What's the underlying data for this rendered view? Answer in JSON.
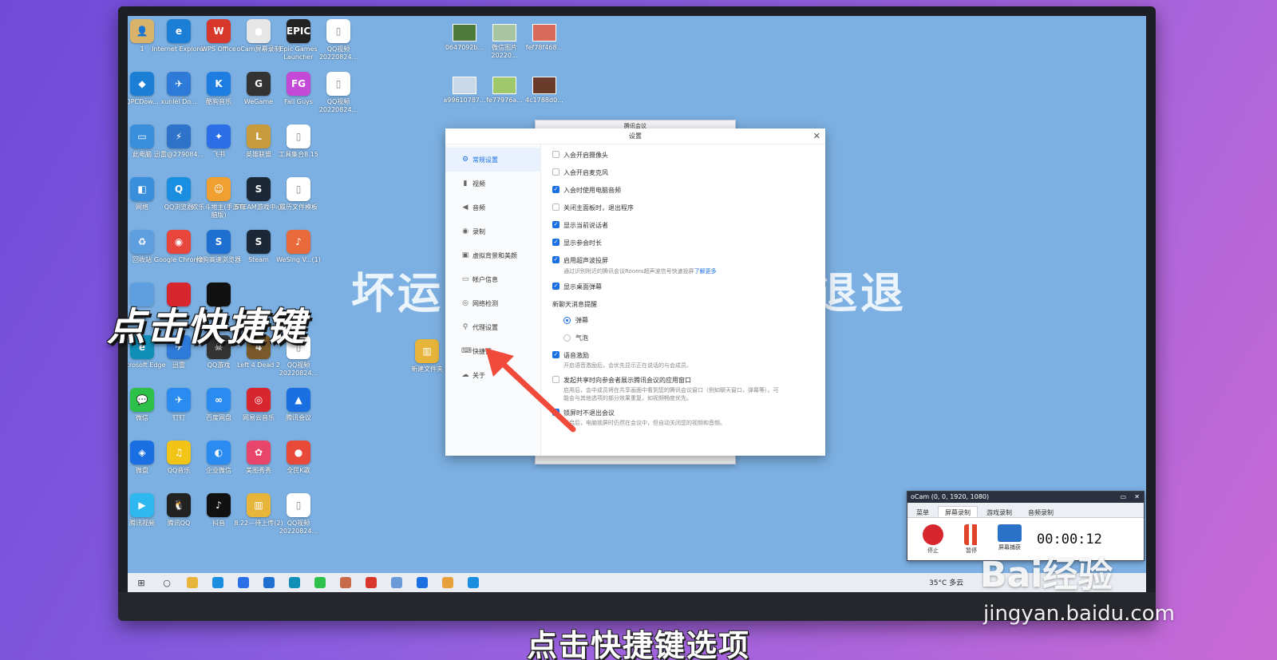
{
  "desktop": {
    "icons": [
      {
        "label": "1",
        "glyph": "👤",
        "color": "#d9b36a"
      },
      {
        "label": "Internet Explorer",
        "glyph": "e",
        "color": "#1c7fd6"
      },
      {
        "label": "WPS Office",
        "glyph": "W",
        "color": "#d8372c"
      },
      {
        "label": "oCam屏幕录制",
        "glyph": "●",
        "color": "#e7e7e7"
      },
      {
        "label": "Epic Games Launcher",
        "glyph": "EPIC",
        "color": "#222222"
      },
      {
        "label": "QQ视频20220824...",
        "glyph": "▯",
        "color": "#ffffff"
      },
      {
        "label": "QPCDow...",
        "glyph": "◆",
        "color": "#1c7fd6"
      },
      {
        "label": "xunlei Do...",
        "glyph": "✈",
        "color": "#2e7ad8"
      },
      {
        "label": "酷狗音乐",
        "glyph": "K",
        "color": "#1e7de0"
      },
      {
        "label": "WeGame",
        "glyph": "G",
        "color": "#333333"
      },
      {
        "label": "Fall Guys",
        "glyph": "FG",
        "color": "#c24ad6"
      },
      {
        "label": "QQ视频20220824...",
        "glyph": "▯",
        "color": "#ffffff"
      },
      {
        "label": "此电脑",
        "glyph": "▭",
        "color": "#3a8fdc"
      },
      {
        "label": "迅雷@279084...",
        "glyph": "⚡",
        "color": "#2d73c9"
      },
      {
        "label": "飞书",
        "glyph": "✦",
        "color": "#2b6fe8"
      },
      {
        "label": "英雄联盟",
        "glyph": "L",
        "color": "#c89b3c"
      },
      {
        "label": "工具集合8.15",
        "glyph": "▯",
        "color": "#ffffff"
      },
      {
        "label": "网络",
        "glyph": "◧",
        "color": "#3a8fdc"
      },
      {
        "label": "QQ浏览器",
        "glyph": "Q",
        "color": "#1a8ee0"
      },
      {
        "label": "欢乐斗地主(手游电脑版)",
        "glyph": "☺",
        "color": "#f0a030"
      },
      {
        "label": "STEAM游戏中心",
        "glyph": "S",
        "color": "#1b2838"
      },
      {
        "label": "履历文件模板",
        "glyph": "▯",
        "color": "#ffffff"
      },
      {
        "label": "回收站",
        "glyph": "♻",
        "color": "#5ea0df"
      },
      {
        "label": "Google Chrome",
        "glyph": "◉",
        "color": "#e8453c"
      },
      {
        "label": "搜狗高速浏览器",
        "glyph": "S",
        "color": "#1f6fd0"
      },
      {
        "label": "Steam",
        "glyph": "S",
        "color": "#1b2838"
      },
      {
        "label": "WeSing V...(1)",
        "glyph": "♪",
        "color": "#e86a3a"
      },
      {
        "label": "Microsoft Edge",
        "glyph": "e",
        "color": "#0f8fb8"
      },
      {
        "label": "迅雷",
        "glyph": "✈",
        "color": "#2e7ad8"
      },
      {
        "label": "QQ游戏",
        "glyph": "☠",
        "color": "#333333"
      },
      {
        "label": "Left 4 Dead 2",
        "glyph": "4",
        "color": "#7a5a2a"
      },
      {
        "label": "QQ视频20220824...",
        "glyph": "▯",
        "color": "#ffffff"
      },
      {
        "label": "微信",
        "glyph": "💬",
        "color": "#2ec14a"
      },
      {
        "label": "钉钉",
        "glyph": "✈",
        "color": "#2a8cf0"
      },
      {
        "label": "百度网盘",
        "glyph": "∞",
        "color": "#2a8cf0"
      },
      {
        "label": "网易云音乐",
        "glyph": "◎",
        "color": "#d8262e"
      },
      {
        "label": "腾讯会议",
        "glyph": "▲",
        "color": "#1a6fe3"
      },
      {
        "label": "微盘",
        "glyph": "◈",
        "color": "#1a6fe3"
      },
      {
        "label": "QQ音乐",
        "glyph": "♫",
        "color": "#f2c417"
      },
      {
        "label": "企业微信",
        "glyph": "◐",
        "color": "#2a8cf0"
      },
      {
        "label": "美图秀秀",
        "glyph": "✿",
        "color": "#e8456a"
      },
      {
        "label": "全民K歌",
        "glyph": "●",
        "color": "#e84a3a"
      },
      {
        "label": "腾讯视频",
        "glyph": "▶",
        "color": "#2fb8ef"
      },
      {
        "label": "腾讯QQ",
        "glyph": "🐧",
        "color": "#222222"
      },
      {
        "label": "抖音",
        "glyph": "♪",
        "color": "#111111"
      },
      {
        "label": "8.22—待上传(2)",
        "glyph": "▥",
        "color": "#e6b53a"
      },
      {
        "label": "QQ视频20220824...",
        "glyph": "▯",
        "color": "#ffffff"
      }
    ],
    "folder_label": "新建文件夹",
    "thumbs": [
      {
        "label": "0647092b...",
        "color": "#4d7a3a"
      },
      {
        "label": "微信图片20220...",
        "color": "#a6c5a0"
      },
      {
        "label": "fef78f468...",
        "color": "#d96a5a"
      },
      {
        "label": "a99610787...",
        "color": "#c8d8e8"
      },
      {
        "label": "fe77976a...",
        "color": "#9ec86a"
      },
      {
        "label": "4c1788d0...",
        "color": "#6a3a2a"
      }
    ],
    "bg_text_left": "坏运",
    "bg_text_right": "退退"
  },
  "behind_window_title": "腾讯会议",
  "settings": {
    "title": "设置",
    "close": "✕",
    "sidebar": [
      {
        "label": "常规设置",
        "icon": "⚙",
        "active": true
      },
      {
        "label": "视频",
        "icon": "▮",
        "active": false
      },
      {
        "label": "音频",
        "icon": "◀",
        "active": false
      },
      {
        "label": "录制",
        "icon": "◉",
        "active": false
      },
      {
        "label": "虚拟背景和美颜",
        "icon": "▣",
        "active": false
      },
      {
        "label": "帐户信息",
        "icon": "▭",
        "active": false
      },
      {
        "label": "网络检测",
        "icon": "◎",
        "active": false
      },
      {
        "label": "代理设置",
        "icon": "⚲",
        "active": false
      },
      {
        "label": "快捷键",
        "icon": "⌨",
        "active": false
      },
      {
        "label": "关于",
        "icon": "☁",
        "active": false
      }
    ],
    "options": [
      {
        "label": "入会开启摄像头",
        "checked": false
      },
      {
        "label": "入会开启麦克风",
        "checked": false
      },
      {
        "label": "入会时使用电脑音频",
        "checked": true
      },
      {
        "label": "关闭主面板时，退出程序",
        "checked": false
      },
      {
        "label": "显示当前说话者",
        "checked": true
      },
      {
        "label": "显示参会时长",
        "checked": true
      },
      {
        "label": "启用超声波投屏",
        "checked": true
      }
    ],
    "ultrasonic_desc": "通过识别附近的腾讯会议Rooms超声波信号快速投屏",
    "learn_more": "了解更多",
    "option_barrage": {
      "label": "显示桌面弹幕",
      "checked": true
    },
    "chat_section": "新聊天消息提醒",
    "radio_options": [
      {
        "label": "弹幕",
        "selected": true
      },
      {
        "label": "气泡",
        "selected": false
      }
    ],
    "voice_option": {
      "label": "语音激励",
      "checked": true
    },
    "voice_desc": "开启语音激励后，会优先显示正在说话的与会成员。",
    "share_option": {
      "label": "发起共享时向参会者展示腾讯会议的应用窗口",
      "checked": false
    },
    "share_desc": "启用后，会中成员将在共享画面中看到您的腾讯会议窗口（例如聊天窗口，弹幕等）。可能会与其他选项的部分效果重复，如视频畅度优先。",
    "lock_option": {
      "label": "锁屏时不退出会议",
      "checked": true
    },
    "lock_desc": "开启后，电脑锁屏时仍然在会议中，但自动关闭您的视频和音频。"
  },
  "ocam": {
    "title": "oCam (0, 0, 1920, 1080)",
    "tabs": [
      {
        "label": "菜单",
        "active": false
      },
      {
        "label": "屏幕录制",
        "active": true
      },
      {
        "label": "游戏录制",
        "active": false
      },
      {
        "label": "音频录制",
        "active": false
      }
    ],
    "buttons": [
      {
        "label": "停止",
        "color": "#d8262e"
      },
      {
        "label": "暂停",
        "color": "#e0452c"
      },
      {
        "label": "屏幕捕获",
        "color": "#2a72c8"
      }
    ],
    "timer": "00:00:12",
    "min": "▭",
    "close": "✕"
  },
  "taskbar": {
    "weather": "35°C  多云",
    "apps": [
      {
        "glyph": "⊞",
        "color": ""
      },
      {
        "glyph": "○",
        "color": ""
      },
      {
        "glyph": "",
        "color": "#e6b53a"
      },
      {
        "glyph": "",
        "color": "#1a8ee0"
      },
      {
        "glyph": "",
        "color": "#2b6fe8"
      },
      {
        "glyph": "",
        "color": "#1f6fd0"
      },
      {
        "glyph": "",
        "color": "#0f8fb8"
      },
      {
        "glyph": "",
        "color": "#2ec14a"
      },
      {
        "glyph": "",
        "color": "#c96a4a"
      },
      {
        "glyph": "",
        "color": "#d8372c"
      },
      {
        "glyph": "",
        "color": "#6a9ad8"
      },
      {
        "glyph": "",
        "color": "#1a6fe3"
      },
      {
        "glyph": "",
        "color": "#e8a03a"
      },
      {
        "glyph": "",
        "color": "#1a8ee0"
      }
    ]
  },
  "overlay": {
    "callout": "点击快捷键",
    "caption": "点击快捷键选项",
    "watermark_logo": "Bai经验",
    "watermark_url": "jingyan.baidu.com"
  },
  "colors": {
    "accent": "#1a6fe3",
    "arrow": "#f04a3a"
  }
}
